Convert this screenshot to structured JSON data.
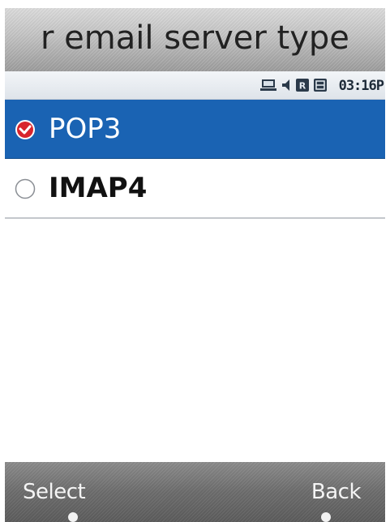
{
  "title": "r email server type",
  "status": {
    "time": "03:16P",
    "icons": [
      "network-icon",
      "speaker-icon",
      "roaming-icon",
      "sms-icon"
    ]
  },
  "options": [
    {
      "label": "POP3",
      "selected": true
    },
    {
      "label": "IMAP4",
      "selected": false
    }
  ],
  "softkeys": {
    "left": "Select",
    "right": "Back"
  },
  "colors": {
    "selection": "#1a63b3",
    "radio_check": "#d8242c"
  }
}
